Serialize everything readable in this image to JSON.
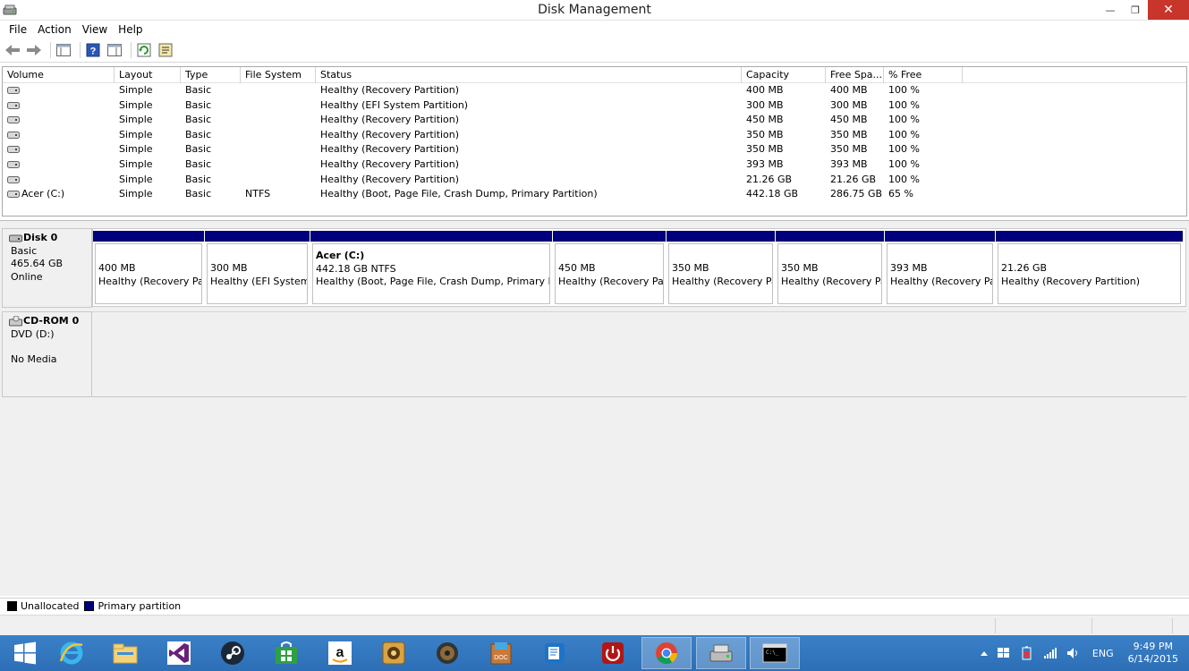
{
  "window": {
    "title": "Disk Management",
    "controls": {
      "minimize": "—",
      "restore": "❐",
      "close": "✕"
    }
  },
  "menu": [
    "File",
    "Action",
    "View",
    "Help"
  ],
  "toolbar": {
    "icons": [
      "back-arrow-icon",
      "forward-arrow-icon",
      "console-tree-icon",
      "help-icon",
      "show-hide-icon",
      "refresh-icon",
      "properties-icon"
    ]
  },
  "volumes": {
    "columns": [
      "Volume",
      "Layout",
      "Type",
      "File System",
      "Status",
      "Capacity",
      "Free Spa...",
      "% Free"
    ],
    "rows": [
      {
        "volume": "",
        "layout": "Simple",
        "type": "Basic",
        "fs": "",
        "status": "Healthy (Recovery Partition)",
        "capacity": "400 MB",
        "free": "400 MB",
        "pct": "100 %"
      },
      {
        "volume": "",
        "layout": "Simple",
        "type": "Basic",
        "fs": "",
        "status": "Healthy (EFI System Partition)",
        "capacity": "300 MB",
        "free": "300 MB",
        "pct": "100 %"
      },
      {
        "volume": "",
        "layout": "Simple",
        "type": "Basic",
        "fs": "",
        "status": "Healthy (Recovery Partition)",
        "capacity": "450 MB",
        "free": "450 MB",
        "pct": "100 %"
      },
      {
        "volume": "",
        "layout": "Simple",
        "type": "Basic",
        "fs": "",
        "status": "Healthy (Recovery Partition)",
        "capacity": "350 MB",
        "free": "350 MB",
        "pct": "100 %"
      },
      {
        "volume": "",
        "layout": "Simple",
        "type": "Basic",
        "fs": "",
        "status": "Healthy (Recovery Partition)",
        "capacity": "350 MB",
        "free": "350 MB",
        "pct": "100 %"
      },
      {
        "volume": "",
        "layout": "Simple",
        "type": "Basic",
        "fs": "",
        "status": "Healthy (Recovery Partition)",
        "capacity": "393 MB",
        "free": "393 MB",
        "pct": "100 %"
      },
      {
        "volume": "",
        "layout": "Simple",
        "type": "Basic",
        "fs": "",
        "status": "Healthy (Recovery Partition)",
        "capacity": "21.26 GB",
        "free": "21.26 GB",
        "pct": "100 %"
      },
      {
        "volume": "Acer (C:)",
        "layout": "Simple",
        "type": "Basic",
        "fs": "NTFS",
        "status": "Healthy (Boot, Page File, Crash Dump, Primary Partition)",
        "capacity": "442.18 GB",
        "free": "286.75 GB",
        "pct": "65 %"
      }
    ]
  },
  "disk0": {
    "name": "Disk 0",
    "kind": "Basic",
    "size": "465.64 GB",
    "state": "Online",
    "partitions": [
      {
        "name": "",
        "size": "400 MB",
        "status": "Healthy (Recovery Pa"
      },
      {
        "name": "",
        "size": "300 MB",
        "status": "Healthy (EFI System"
      },
      {
        "name": "Acer  (C:)",
        "size": "442.18 GB NTFS",
        "status": "Healthy (Boot, Page File, Crash Dump, Primary Pa"
      },
      {
        "name": "",
        "size": "450 MB",
        "status": "Healthy (Recovery Pa"
      },
      {
        "name": "",
        "size": "350 MB",
        "status": "Healthy (Recovery Pa"
      },
      {
        "name": "",
        "size": "350 MB",
        "status": "Healthy (Recovery Pa"
      },
      {
        "name": "",
        "size": "393 MB",
        "status": "Healthy (Recovery Pa"
      },
      {
        "name": "",
        "size": "21.26 GB",
        "status": "Healthy (Recovery Partition)"
      }
    ]
  },
  "cdrom0": {
    "name": "CD-ROM 0",
    "drive": "DVD (D:)",
    "media": "No Media"
  },
  "legend": {
    "unallocated": "Unallocated",
    "primary": "Primary partition",
    "colors": {
      "unallocated": "#000000",
      "primary": "#00007f"
    }
  },
  "taskbar": {
    "apps": [
      "start-icon",
      "internet-explorer-icon",
      "file-explorer-icon",
      "visual-studio-icon",
      "steam-icon",
      "store-icon",
      "amazon-icon",
      "media-player-icon",
      "speaker-icon",
      "docs-icon",
      "app-icon",
      "power-icon",
      "chrome-icon",
      "disk-management-icon",
      "command-prompt-icon"
    ],
    "language": "ENG",
    "time": "9:49 PM",
    "date": "6/14/2015"
  }
}
